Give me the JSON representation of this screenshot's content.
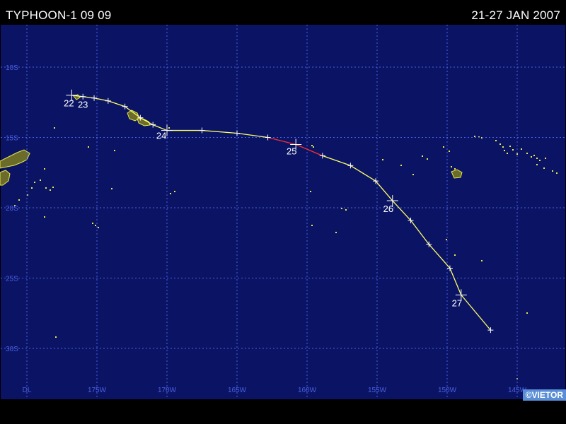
{
  "header": {
    "title": "TYPHOON-1 09 09",
    "date_range": "21-27 JAN 2007"
  },
  "credit": "©VIETOR",
  "colors": {
    "ocean": "#0b1464",
    "grid": "#4a5fe0",
    "axis_label": "#4a5fe0",
    "land_fill": "#6b6b2a",
    "land_outline": "#e8e84a",
    "track_main": "#ffff66",
    "track_alt": "#ff3030",
    "marker": "#ffffff",
    "day_label": "#ffffff"
  },
  "axes": {
    "lon_ticks": [
      "DL",
      "175W",
      "170W",
      "165W",
      "160W",
      "155W",
      "150W",
      "145W"
    ],
    "lat_ticks": [
      "10S",
      "15S",
      "20S",
      "25S",
      "30S"
    ],
    "lon_values": [
      180,
      175,
      170,
      165,
      160,
      155,
      150,
      145
    ],
    "lat_values": [
      10,
      15,
      20,
      25,
      30
    ]
  },
  "track": {
    "points": [
      {
        "lon": 176.8,
        "lat": 12.0
      },
      {
        "lon": 176.0,
        "lat": 12.1
      },
      {
        "lon": 175.2,
        "lat": 12.2
      },
      {
        "lon": 174.2,
        "lat": 12.4
      },
      {
        "lon": 173.0,
        "lat": 12.8
      },
      {
        "lon": 171.9,
        "lat": 13.6
      },
      {
        "lon": 171.0,
        "lat": 14.1
      },
      {
        "lon": 170.0,
        "lat": 14.5
      },
      {
        "lon": 167.5,
        "lat": 14.5
      },
      {
        "lon": 165.0,
        "lat": 14.7
      },
      {
        "lon": 162.8,
        "lat": 15.0
      },
      {
        "lon": 160.8,
        "lat": 15.5
      },
      {
        "lon": 158.9,
        "lat": 16.3
      },
      {
        "lon": 156.9,
        "lat": 17.0
      },
      {
        "lon": 155.1,
        "lat": 18.1
      },
      {
        "lon": 153.9,
        "lat": 19.5
      },
      {
        "lon": 152.6,
        "lat": 20.9
      },
      {
        "lon": 151.3,
        "lat": 22.6
      },
      {
        "lon": 149.8,
        "lat": 24.3
      },
      {
        "lon": 149.0,
        "lat": 26.2
      },
      {
        "lon": 146.9,
        "lat": 28.7
      }
    ],
    "red_segment_range": [
      10,
      12
    ],
    "major_markers": [
      0,
      7,
      11,
      15,
      19
    ],
    "day_labels": [
      {
        "label": "22",
        "lon": 177.0,
        "lat": 12.6
      },
      {
        "label": "23",
        "lon": 176.0,
        "lat": 12.7
      },
      {
        "label": "24",
        "lon": 170.4,
        "lat": 14.9
      },
      {
        "label": "25",
        "lon": 161.1,
        "lat": 16.0
      },
      {
        "label": "26",
        "lon": 154.2,
        "lat": 20.1
      },
      {
        "label": "27",
        "lon": 149.3,
        "lat": 26.8
      }
    ]
  }
}
